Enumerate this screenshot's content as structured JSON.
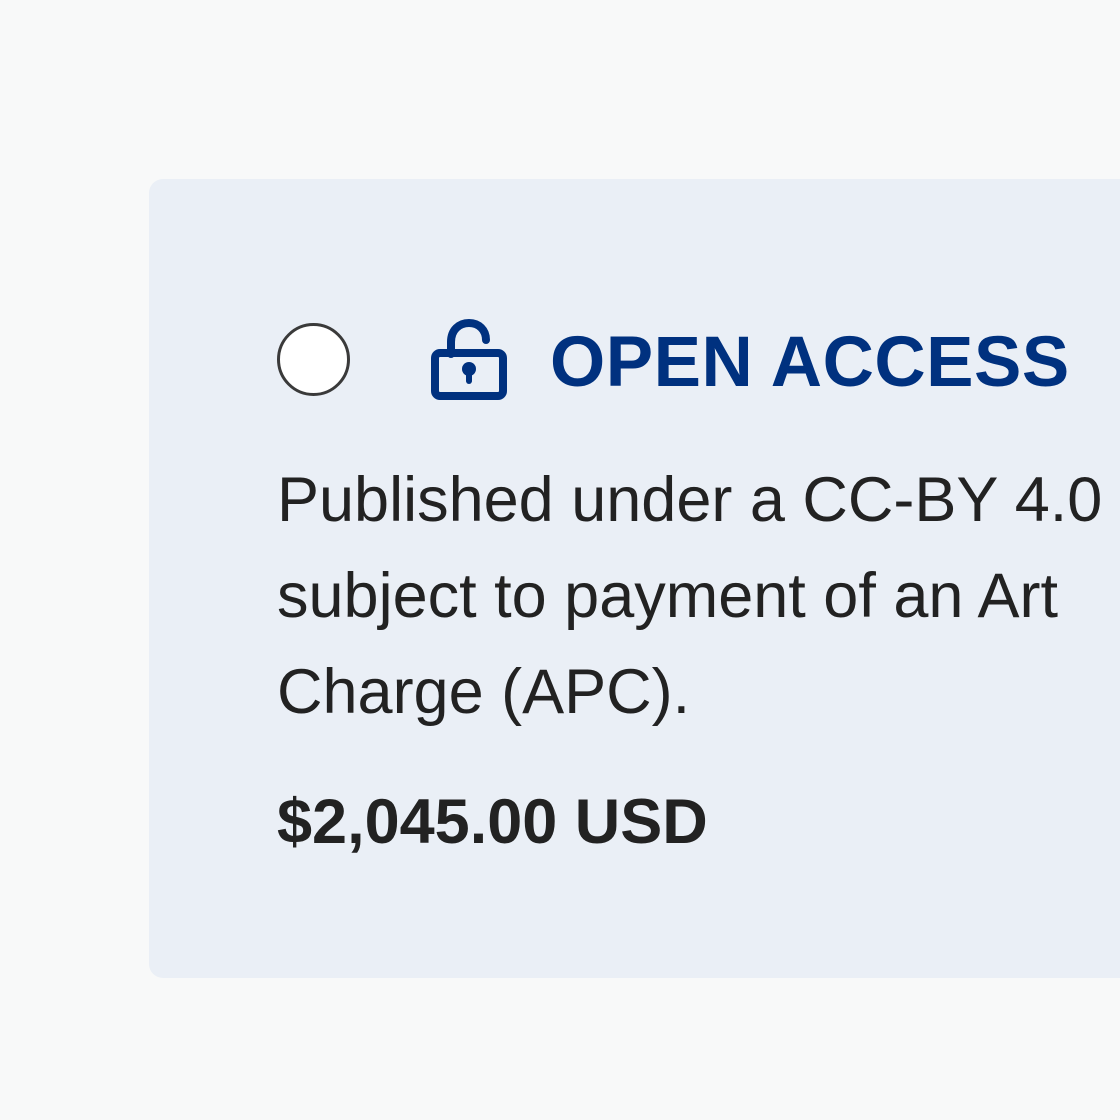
{
  "option": {
    "title": "OPEN ACCESS",
    "icon": "unlocked-padlock-icon",
    "description_lines": [
      "Published under a CC-BY 4.0",
      "subject to payment of an Art",
      "Charge (APC)."
    ],
    "price": "$2,045.00 USD",
    "selected": false
  },
  "colors": {
    "page_background": "#f8f9f9",
    "card_background": "#eaeff6",
    "accent": "#00317f",
    "text": "#222222"
  }
}
